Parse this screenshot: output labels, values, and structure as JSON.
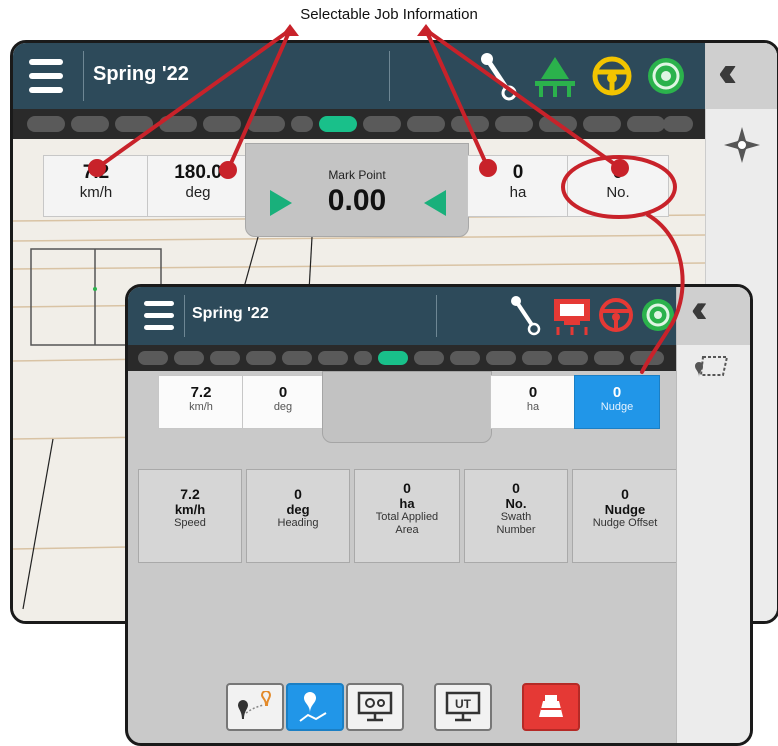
{
  "callout": {
    "title": "Selectable Job Information"
  },
  "back": {
    "job_title": "Spring '22",
    "center": {
      "label": "Mark Point",
      "value": "0.00"
    },
    "items": [
      {
        "value": "7.2",
        "unit": "km/h"
      },
      {
        "value": "180.0",
        "unit": "deg"
      },
      {
        "value": "0",
        "unit": "ha"
      },
      {
        "value": "0",
        "unit": "No."
      }
    ]
  },
  "front": {
    "job_title": "Spring '22",
    "items": [
      {
        "value": "7.2",
        "unit": "km/h"
      },
      {
        "value": "0",
        "unit": "deg"
      },
      {
        "value": "0",
        "unit": "ha"
      },
      {
        "value": "0",
        "unit": "Nudge"
      }
    ],
    "tiles": [
      {
        "value": "7.2",
        "unit": "km/h",
        "desc": "Speed"
      },
      {
        "value": "0",
        "unit": "deg",
        "desc": "Heading"
      },
      {
        "value": "0",
        "unit": "ha",
        "desc": "Total Applied Area"
      },
      {
        "value": "0",
        "unit": "No.",
        "desc": "Swath Number"
      },
      {
        "value": "0",
        "unit": "Nudge",
        "desc": "Nudge Offset"
      }
    ],
    "bottom_buttons": [
      "guidance-points-icon",
      "map-pin-icon",
      "settings-monitor-icon",
      "ut-monitor-icon",
      "machine-alert-icon"
    ]
  },
  "colors": {
    "topbar": "#2d4a5a",
    "accent_green": "#19c08a",
    "selected_blue": "#2196e8",
    "callout_red": "#c8222a",
    "alert_red": "#e53935"
  }
}
